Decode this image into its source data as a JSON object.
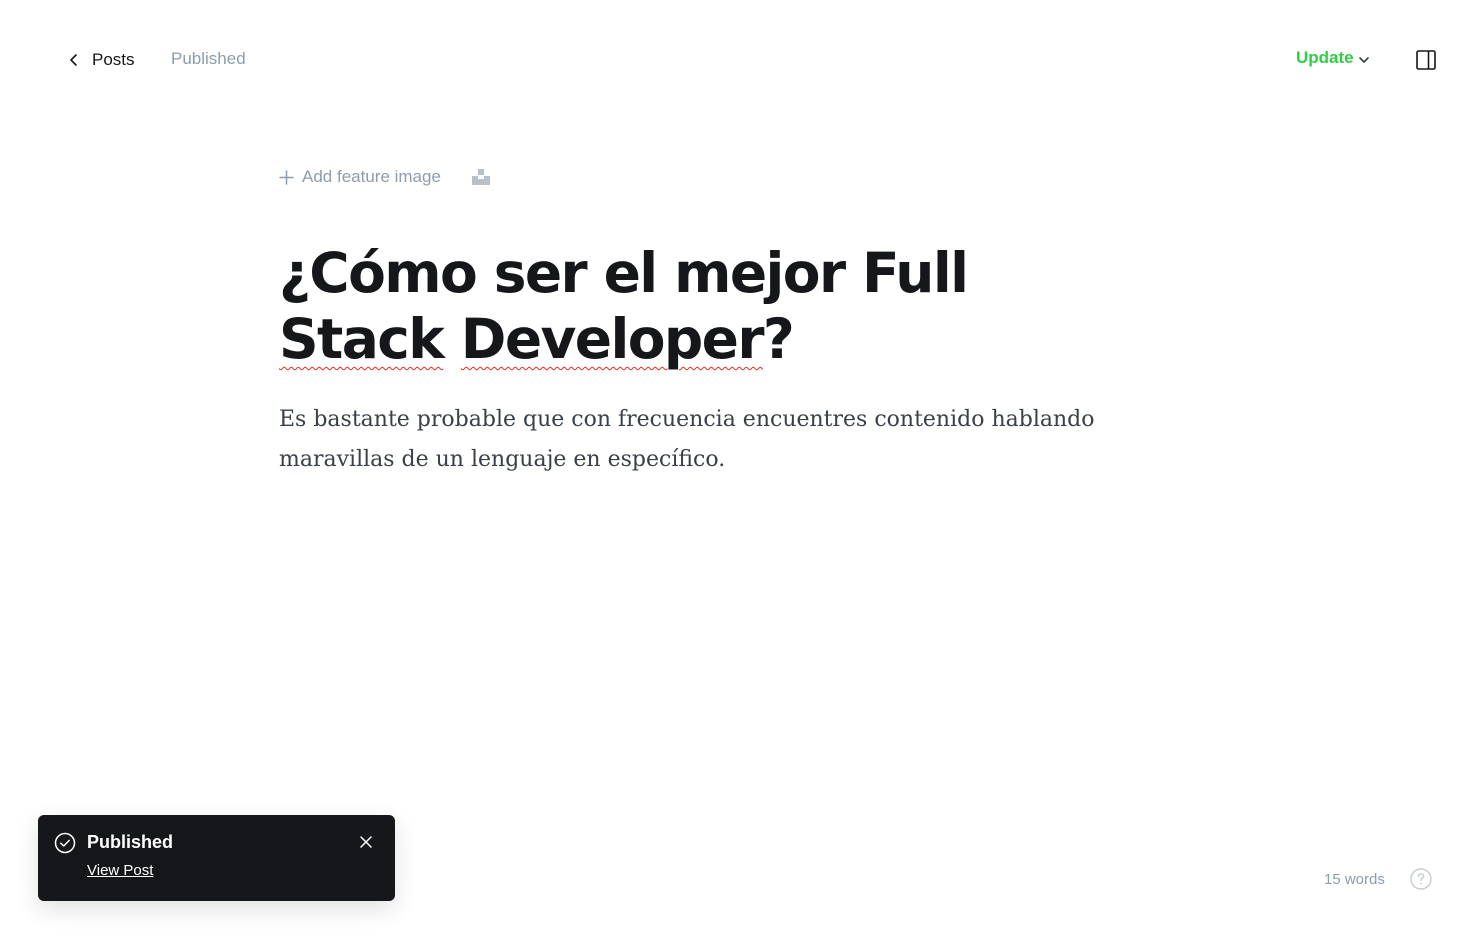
{
  "header": {
    "back_label": "Posts",
    "status": "Published",
    "update_label": "Update",
    "icons": {
      "back": "chevron-left-icon",
      "update_dropdown": "chevron-down-icon",
      "sidebar": "sidebar-panel-icon"
    }
  },
  "editor": {
    "add_feature_image": "Add feature image",
    "title_parts": [
      "¿Cómo ser el mejor Full ",
      "Stack",
      " ",
      "Developer",
      "?"
    ],
    "excerpt": "Es bastante probable que con frecuencia encuentres contenido hablando maravillas de un lenguaje en específico.",
    "icons": {
      "add": "plus-icon",
      "unsplash": "unsplash-icon"
    }
  },
  "toast": {
    "title": "Published",
    "link": "View Post",
    "icons": {
      "status": "check-circle-icon",
      "close": "close-icon"
    }
  },
  "footer": {
    "word_count": "15 words",
    "help_icon": "help-circle-icon"
  },
  "colors": {
    "accent_green": "#30cf43",
    "muted_gray": "#8e9cac",
    "text_dark": "#15171a",
    "spellcheck_red": "#e5281e"
  }
}
